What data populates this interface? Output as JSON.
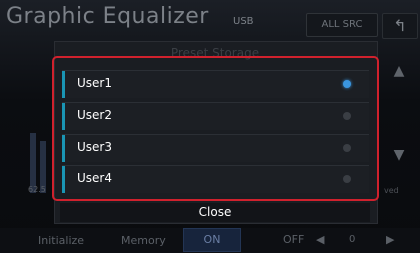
{
  "header": {
    "title": "Graphic Equalizer",
    "source": "USB",
    "all_src_label": "ALL SRC",
    "back_icon": "back-arrow-icon"
  },
  "eq": {
    "freq_label": "62.5"
  },
  "side": {
    "up_icon": "arrow-up-icon",
    "down_icon": "arrow-down-icon",
    "ved_label": "ved"
  },
  "dialog": {
    "title": "Preset Storage",
    "items": [
      {
        "label": "User1",
        "selected": true
      },
      {
        "label": "User2",
        "selected": false
      },
      {
        "label": "User3",
        "selected": false
      },
      {
        "label": "User4",
        "selected": false
      }
    ],
    "close_label": "Close",
    "highlight_color": "#d0212d",
    "accent_color": "#1a95b4"
  },
  "bottom": {
    "initialize_label": "Initialize",
    "memory_label": "Memory",
    "on_label": "ON",
    "off_label": "OFF",
    "value": "0"
  }
}
